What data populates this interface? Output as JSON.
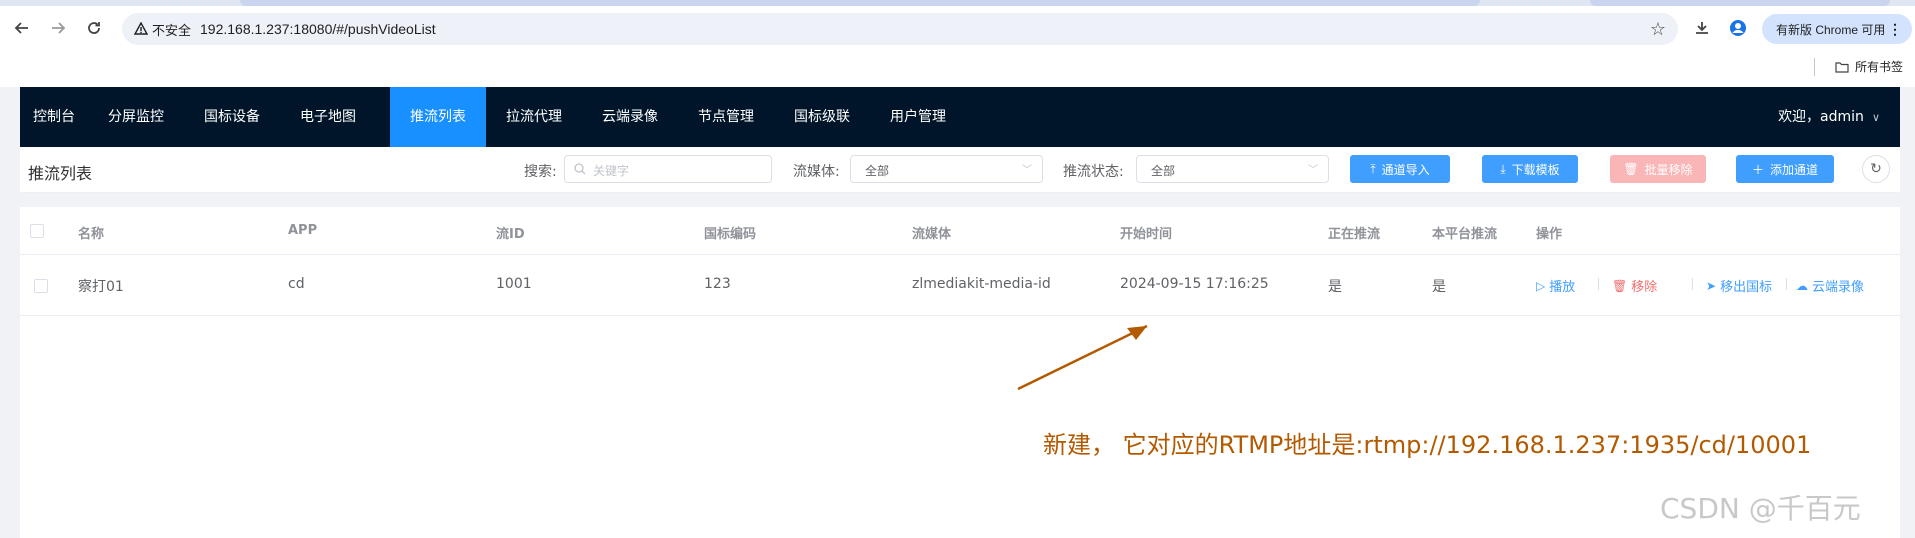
{
  "browser": {
    "security_label": "不安全",
    "url": "192.168.1.237:18080/#/pushVideoList",
    "update_label": "有新版 Chrome 可用",
    "all_bookmarks": "所有书签"
  },
  "nav": {
    "items": [
      {
        "label": "控制台"
      },
      {
        "label": "分屏监控"
      },
      {
        "label": "国标设备"
      },
      {
        "label": "电子地图"
      },
      {
        "label": "推流列表",
        "active": true
      },
      {
        "label": "拉流代理"
      },
      {
        "label": "云端录像"
      },
      {
        "label": "节点管理"
      },
      {
        "label": "国标级联"
      },
      {
        "label": "用户管理"
      }
    ],
    "welcome": "欢迎，admin"
  },
  "header": {
    "title": "推流列表",
    "search_label": "搜索:",
    "search_placeholder": "关键字",
    "media_label": "流媒体:",
    "media_value": "全部",
    "status_label": "推流状态:",
    "status_value": "全部",
    "import_button": "通道导入",
    "download_button": "下载模板",
    "batch_remove_button": "批量移除",
    "add_button": "添加通道"
  },
  "table": {
    "columns": [
      "名称",
      "APP",
      "流ID",
      "国标编码",
      "流媒体",
      "开始时间",
      "正在推流",
      "本平台推流",
      "操作"
    ],
    "rows": [
      {
        "name": "察打01",
        "app": "cd",
        "stream_id": "1001",
        "gb_code": "123",
        "media": "zlmediakit-media-id",
        "start_time": "2024-09-15 17:16:25",
        "pushing": "是",
        "local_push": "是",
        "actions": {
          "play": "播放",
          "remove": "移除",
          "remove_gb": "移出国标",
          "cloud_record": "云端录像"
        }
      }
    ]
  },
  "annotation": {
    "text": "新建，  它对应的RTMP地址是:rtmp://192.168.1.237:1935/cd/10001",
    "color": "#b35a00"
  },
  "watermark": "CSDN @千百元",
  "colors": {
    "nav_bg": "#001529",
    "nav_active": "#1890ff",
    "primary": "#409eff",
    "danger": "#f56c6c"
  }
}
